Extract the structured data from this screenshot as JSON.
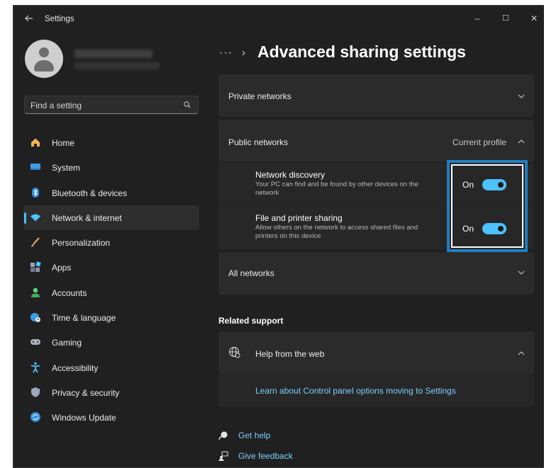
{
  "window": {
    "title": "Settings",
    "controls": {
      "minimize": "–",
      "maximize": "☐",
      "close": "✕"
    }
  },
  "sidebar": {
    "search_placeholder": "Find a setting",
    "items": [
      {
        "label": "Home",
        "icon": "home-icon"
      },
      {
        "label": "System",
        "icon": "system-icon"
      },
      {
        "label": "Bluetooth & devices",
        "icon": "bluetooth-icon"
      },
      {
        "label": "Network & internet",
        "icon": "wifi-icon",
        "active": true
      },
      {
        "label": "Personalization",
        "icon": "brush-icon"
      },
      {
        "label": "Apps",
        "icon": "apps-icon"
      },
      {
        "label": "Accounts",
        "icon": "account-icon"
      },
      {
        "label": "Time & language",
        "icon": "globe-clock-icon"
      },
      {
        "label": "Gaming",
        "icon": "gamepad-icon"
      },
      {
        "label": "Accessibility",
        "icon": "accessibility-icon"
      },
      {
        "label": "Privacy & security",
        "icon": "shield-icon"
      },
      {
        "label": "Windows Update",
        "icon": "update-icon"
      }
    ]
  },
  "main": {
    "breadcrumb_dots": "···",
    "breadcrumb_sep": "›",
    "title": "Advanced sharing settings",
    "private_networks": "Private networks",
    "public_networks": {
      "label": "Public networks",
      "status": "Current profile",
      "settings": [
        {
          "title": "Network discovery",
          "description": "Your PC can find and be found by other devices on the network",
          "state_label": "On",
          "on": true
        },
        {
          "title": "File and printer sharing",
          "description": "Allow others on the network to access shared files and printers on this device",
          "state_label": "On",
          "on": true
        }
      ]
    },
    "all_networks": "All networks",
    "related_support": {
      "heading": "Related support",
      "help_title": "Help from the web",
      "help_link": "Learn about Control panel options moving to Settings"
    },
    "footer": {
      "get_help": "Get help",
      "give_feedback": "Give feedback"
    }
  },
  "colors": {
    "accent": "#4cc2ff",
    "highlight_box": "#1f7fc0",
    "background": "#202020",
    "card": "#2b2b2b"
  }
}
